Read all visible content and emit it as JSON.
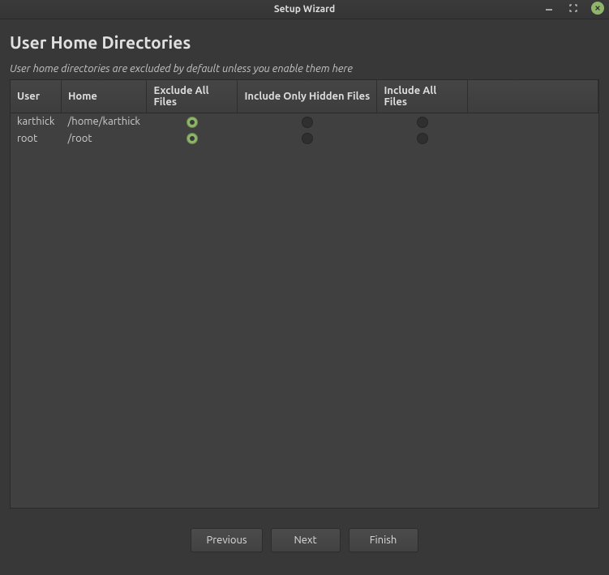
{
  "window": {
    "title": "Setup Wizard"
  },
  "page": {
    "title": "User Home Directories",
    "description": "User home directories are excluded by default unless you enable them here"
  },
  "table": {
    "headers": {
      "user": "User",
      "home": "Home",
      "exclude": "Exclude All Files",
      "hidden": "Include Only Hidden Files",
      "include": "Include All Files"
    },
    "rows": [
      {
        "user": "karthick",
        "home": "/home/karthick",
        "selected": "exclude"
      },
      {
        "user": "root",
        "home": "/root",
        "selected": "exclude"
      }
    ]
  },
  "buttons": {
    "previous": "Previous",
    "next": "Next",
    "finish": "Finish"
  }
}
